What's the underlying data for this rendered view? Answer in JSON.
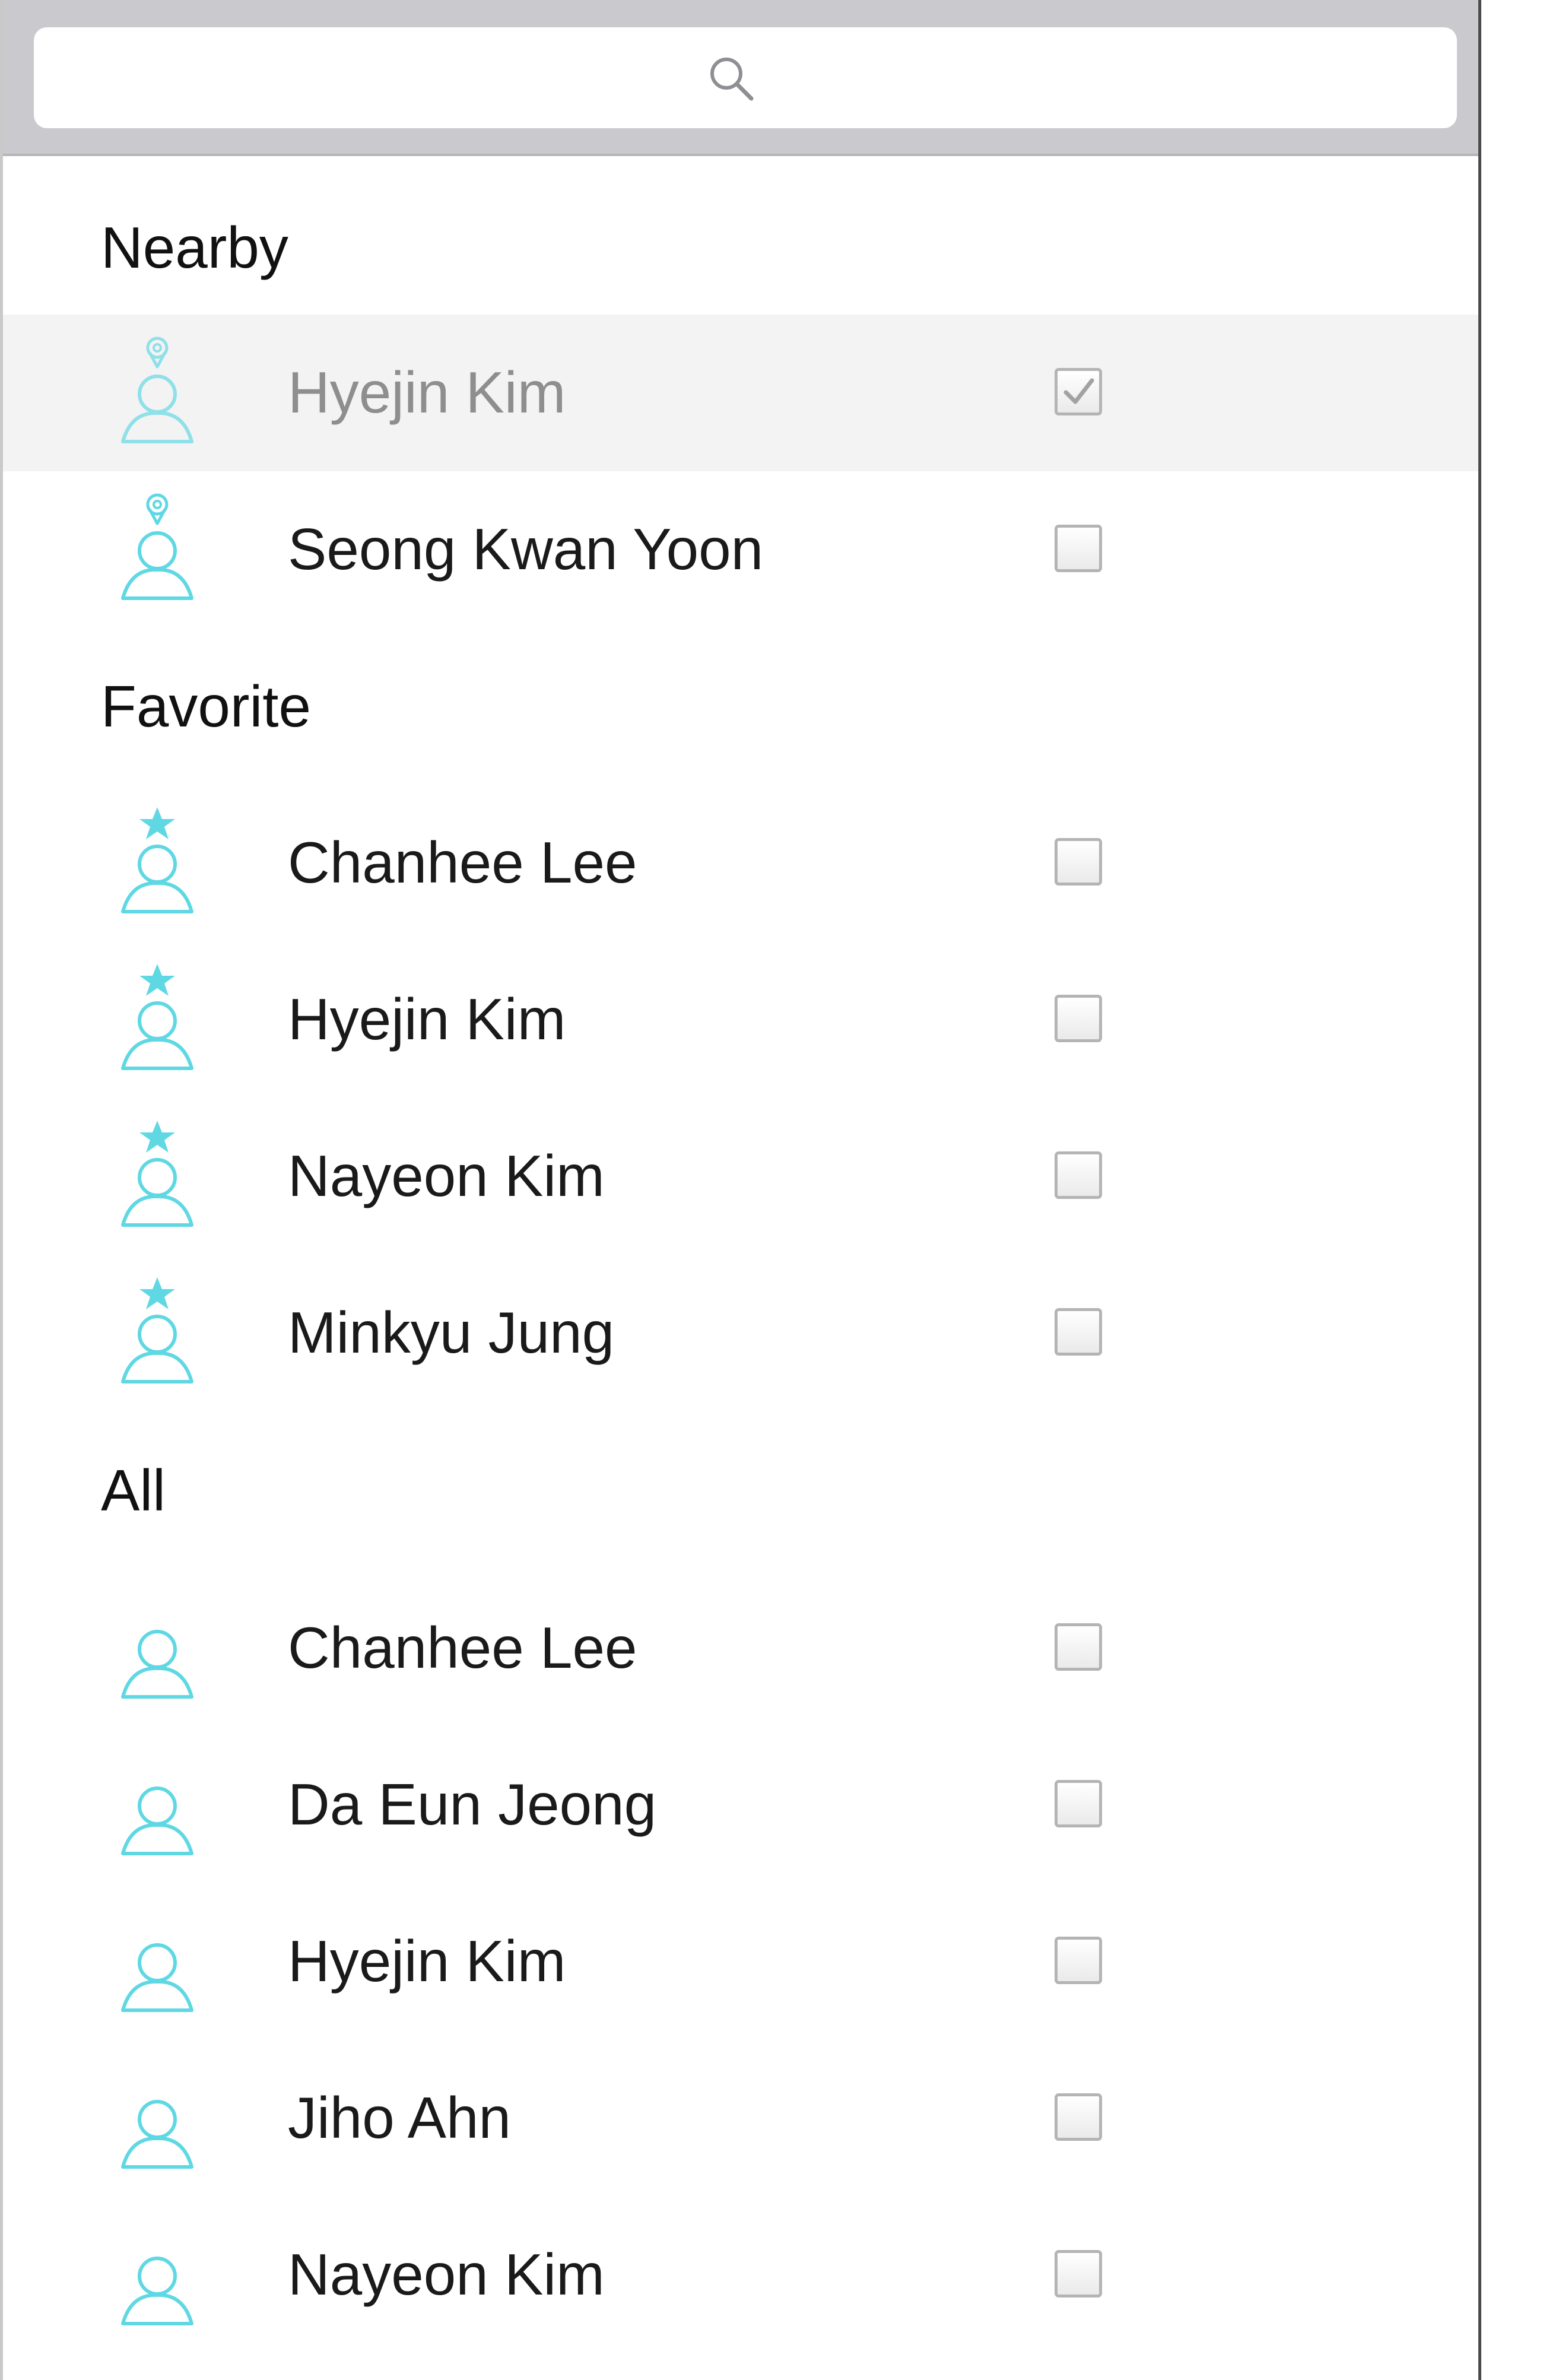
{
  "search": {
    "placeholder": "",
    "icon": "search-icon"
  },
  "accent_color": "#5fd8e3",
  "sections": [
    {
      "title": "Nearby",
      "icon": "person-location-icon",
      "items": [
        {
          "name": "Hyejin Kim",
          "checked": true,
          "highlighted": true
        },
        {
          "name": "Seong Kwan Yoon",
          "checked": false,
          "highlighted": false
        }
      ]
    },
    {
      "title": "Favorite",
      "icon": "person-star-icon",
      "items": [
        {
          "name": "Chanhee Lee",
          "checked": false,
          "highlighted": false
        },
        {
          "name": "Hyejin Kim",
          "checked": false,
          "highlighted": false
        },
        {
          "name": "Nayeon Kim",
          "checked": false,
          "highlighted": false
        },
        {
          "name": "Minkyu Jung",
          "checked": false,
          "highlighted": false
        }
      ]
    },
    {
      "title": "All",
      "icon": "person-icon",
      "items": [
        {
          "name": "Chanhee Lee",
          "checked": false,
          "highlighted": false
        },
        {
          "name": "Da Eun Jeong",
          "checked": false,
          "highlighted": false
        },
        {
          "name": "Hyejin Kim",
          "checked": false,
          "highlighted": false
        },
        {
          "name": "Jiho Ahn",
          "checked": false,
          "highlighted": false
        },
        {
          "name": "Nayeon Kim",
          "checked": false,
          "highlighted": false
        }
      ]
    }
  ]
}
